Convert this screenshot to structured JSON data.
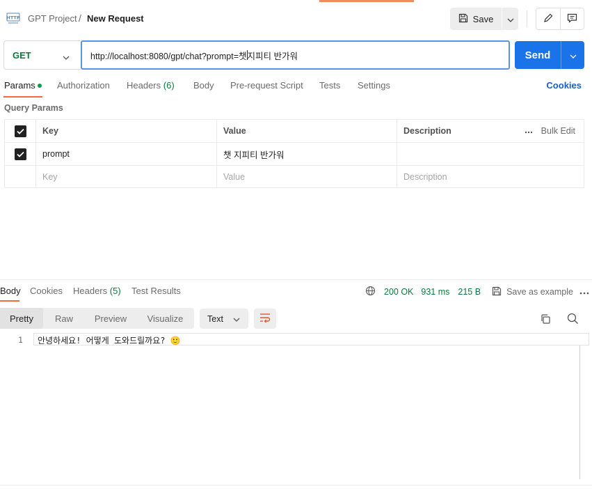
{
  "header": {
    "icon": "http-icon",
    "breadcrumb_parent": "GPT Project",
    "breadcrumb_sep": "/",
    "breadcrumb_current": "New Request",
    "save_label": "Save"
  },
  "request": {
    "method": "GET",
    "url_before_cursor": "http://localhost:8080/gpt/chat?prompt=챗",
    "url_after_cursor": "지피티 반가워",
    "send_label": "Send"
  },
  "tabs": {
    "params": "Params",
    "authorization": "Authorization",
    "headers": "Headers",
    "headers_count": "(6)",
    "body": "Body",
    "prerequest": "Pre-request Script",
    "tests": "Tests",
    "settings": "Settings",
    "cookies": "Cookies"
  },
  "query_params": {
    "title": "Query Params",
    "columns": {
      "key": "Key",
      "value": "Value",
      "description": "Description"
    },
    "bulk_edit": "Bulk Edit",
    "rows": [
      {
        "enabled": true,
        "key": "prompt",
        "value": "챗 지피티 반가워",
        "description": ""
      }
    ],
    "placeholder": {
      "key": "Key",
      "value": "Value",
      "description": "Description"
    }
  },
  "response": {
    "tabs": {
      "body": "Body",
      "cookies": "Cookies",
      "headers": "Headers",
      "headers_count": "(5)",
      "test_results": "Test Results"
    },
    "status": "200 OK",
    "time": "931 ms",
    "size": "215 B",
    "save_example": "Save as example",
    "views": [
      "Pretty",
      "Raw",
      "Preview",
      "Visualize"
    ],
    "format": "Text",
    "lines": [
      {
        "num": "1",
        "text": "안녕하세요! 어떻게 도와드릴까요? 🙂"
      }
    ]
  },
  "colors": {
    "accent": "#f26b3a",
    "send": "#1a73e8",
    "method_get": "#0b7a3a",
    "status_ok": "#0b7a3a"
  }
}
